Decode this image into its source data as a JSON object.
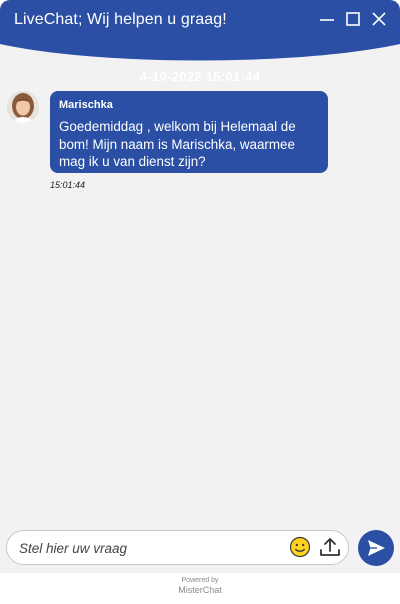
{
  "header": {
    "title": "LiveChat; Wij helpen u graag!",
    "color": "#2a4fa4",
    "controls": [
      {
        "icon": "minimize-icon",
        "label": "minimize"
      },
      {
        "icon": "maximize-icon",
        "label": "maximize"
      },
      {
        "icon": "close-icon",
        "label": "close"
      }
    ]
  },
  "conversation": {
    "date_line": "4-10-2022 15:01:44",
    "messages": [
      {
        "sender": "Marischka",
        "avatar": "agent-avatar",
        "text": "Goedemiddag , welkom bij Helemaal de bom! Mijn naam is Marischka, waarmee mag ik u van dienst zijn?",
        "time": "15:01:44"
      }
    ]
  },
  "composer": {
    "placeholder": "Stel hier uw vraag",
    "value": "",
    "emoji_icon": "smiley-icon",
    "upload_icon": "upload-icon",
    "send_icon": "send-icon"
  },
  "footer": {
    "powered_by": "Powered by",
    "brand": "MisterChat"
  }
}
